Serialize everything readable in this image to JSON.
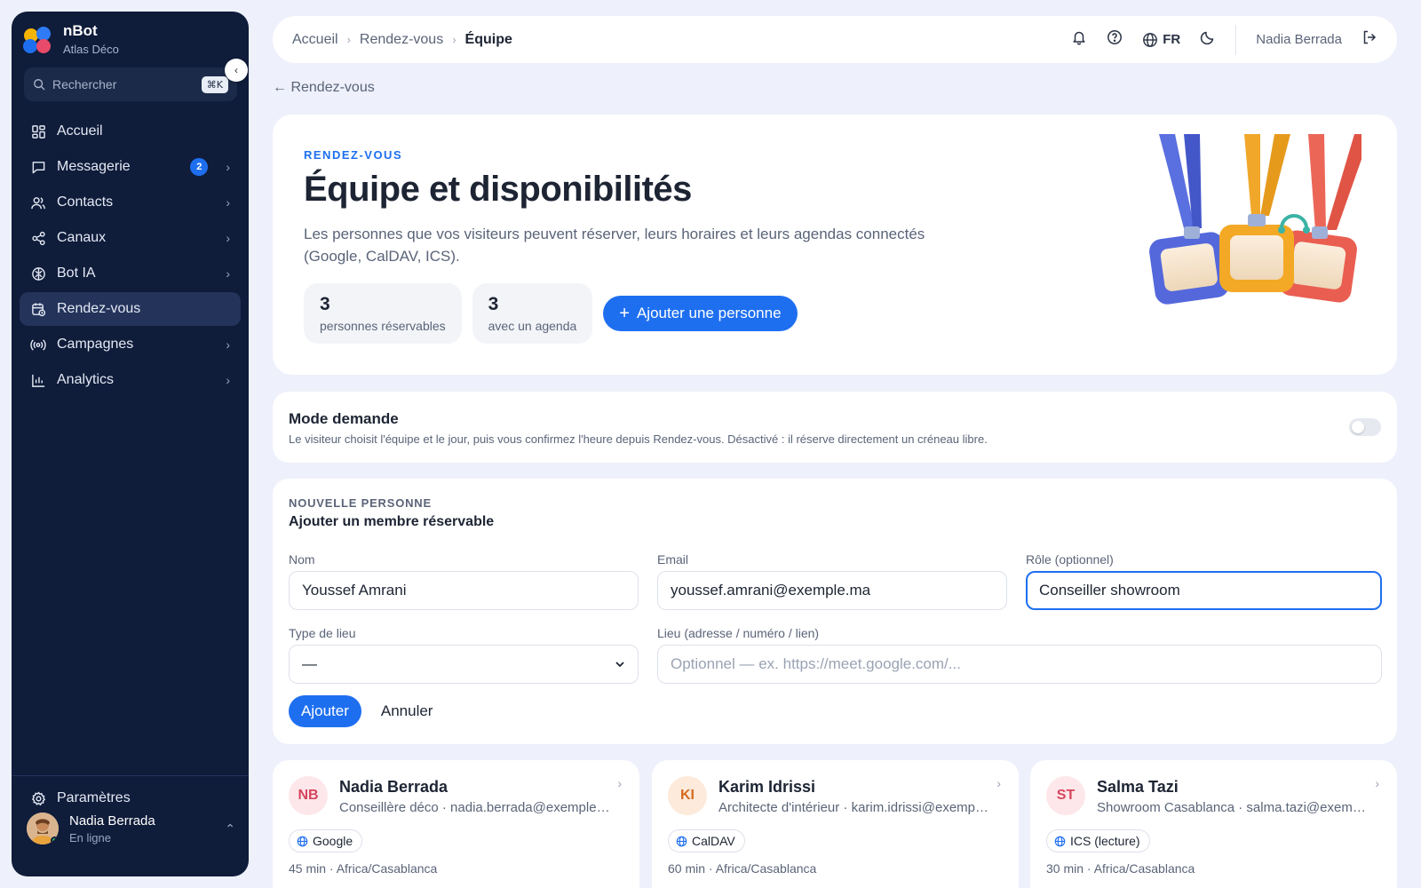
{
  "sidebar": {
    "brand_name": "nBot",
    "brand_sub": "Atlas Déco",
    "search_placeholder": "Rechercher",
    "search_shortcut": "⌘K",
    "items": [
      {
        "label": "Accueil"
      },
      {
        "label": "Messagerie",
        "badge": "2"
      },
      {
        "label": "Contacts"
      },
      {
        "label": "Canaux"
      },
      {
        "label": "Bot IA"
      },
      {
        "label": "Rendez-vous"
      },
      {
        "label": "Campagnes"
      },
      {
        "label": "Analytics"
      }
    ],
    "settings_label": "Paramètres",
    "user_name": "Nadia Berrada",
    "user_status": "En ligne"
  },
  "topbar": {
    "breadcrumbs": [
      "Accueil",
      "Rendez-vous",
      "Équipe"
    ],
    "lang": "FR",
    "user_name": "Nadia Berrada"
  },
  "back_link": "← Rendez-vous",
  "hero": {
    "eyebrow": "RENDEZ-VOUS",
    "title": "Équipe et disponibilités",
    "description": "Les personnes que vos visiteurs peuvent réserver, leurs horaires et leurs agendas connectés (Google, CalDAV, ICS).",
    "stats": [
      {
        "value": "3",
        "label": "personnes réservables"
      },
      {
        "value": "3",
        "label": "avec un agenda"
      }
    ],
    "add_button": "Ajouter une personne"
  },
  "mode": {
    "title": "Mode demande",
    "description": "Le visiteur choisit l'équipe et le jour, puis vous confirmez l'heure depuis Rendez-vous. Désactivé : il réserve directement un créneau libre."
  },
  "form": {
    "eyebrow": "NOUVELLE PERSONNE",
    "title": "Ajouter un membre réservable",
    "name_label": "Nom",
    "name_value": "Youssef Amrani",
    "email_label": "Email",
    "email_value": "youssef.amrani@exemple.ma",
    "role_label": "Rôle (optionnel)",
    "role_value": "Conseiller showroom",
    "type_label": "Type de lieu",
    "type_value": "—",
    "location_label": "Lieu (adresse / numéro / lien)",
    "location_placeholder": "Optionnel — ex. https://meet.google.com/...",
    "submit_label": "Ajouter",
    "cancel_label": "Annuler"
  },
  "members": [
    {
      "initials": "NB",
      "name": "Nadia Berrada",
      "subtitle": "Conseillère déco · nadia.berrada@exemple.ma",
      "calendar": "Google",
      "meta": "45 min · Africa/Casablanca"
    },
    {
      "initials": "KI",
      "name": "Karim Idrissi",
      "subtitle": "Architecte d'intérieur · karim.idrissi@exemple.ma",
      "calendar": "CalDAV",
      "meta": "60 min · Africa/Casablanca"
    },
    {
      "initials": "ST",
      "name": "Salma Tazi",
      "subtitle": "Showroom Casablanca · salma.tazi@exemple.ma",
      "calendar": "ICS (lecture)",
      "meta": "30 min · Africa/Casablanca"
    }
  ],
  "colors": {
    "accent": "#1e6ff0",
    "sidebar_bg": "#0f1c3a",
    "page_bg": "#eef0fb"
  }
}
